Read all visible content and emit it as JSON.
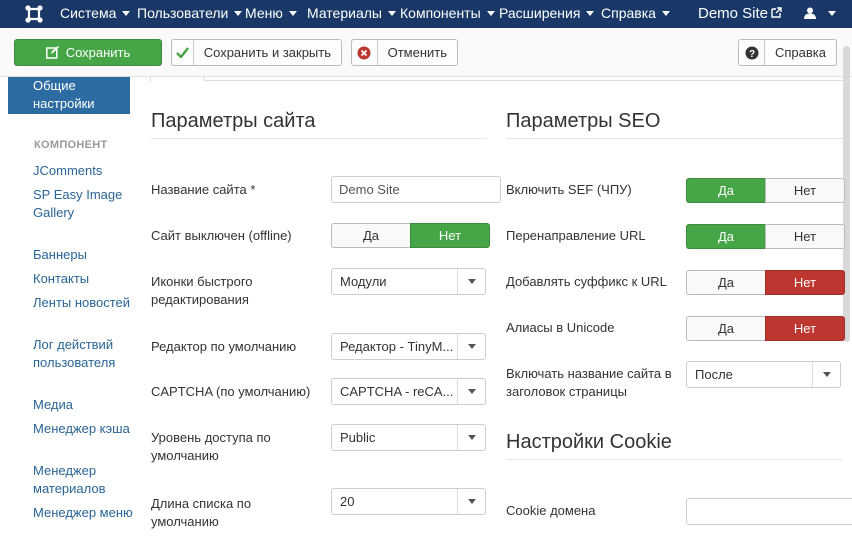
{
  "navbar": {
    "menu": [
      "Система",
      "Пользователи",
      "Меню",
      "Материалы",
      "Компоненты",
      "Расширения",
      "Справка"
    ],
    "brand": "Demo Site"
  },
  "toolbar": {
    "save": "Сохранить",
    "save_close": "Сохранить и закрыть",
    "cancel": "Отменить",
    "help": "Справка"
  },
  "sidebar": {
    "active": "Общие настройки",
    "component_heading": "КОМПОНЕНТ",
    "items": [
      "JComments",
      "SP Easy Image Gallery",
      "Баннеры",
      "Контакты",
      "Ленты новостей",
      "Лог действий пользователя",
      "Медиа",
      "Менеджер кэша",
      "Менеджер материалов",
      "Менеджер меню"
    ]
  },
  "site": {
    "title": "Параметры сайта",
    "name_label": "Название сайта *",
    "name_value": "Demo Site",
    "offline_label": "Сайт выключен (offline)",
    "offline_yes": "Да",
    "offline_no": "Нет",
    "frontedit_label": "Иконки быстрого редактирования",
    "frontedit_value": "Модули",
    "editor_label": "Редактор по умолчанию",
    "editor_value": "Редактор - TinyM...",
    "captcha_label": "CAPTCHA (по умолчанию)",
    "captcha_value": "CAPTCHA - reCA...",
    "access_label": "Уровень доступа по умолчанию",
    "access_value": "Public",
    "list_label": "Длина списка по умолчанию",
    "list_value": "20"
  },
  "seo": {
    "title": "Параметры SEO",
    "sef_label": "Включить SEF (ЧПУ)",
    "rewrite_label": "Перенаправление URL",
    "suffix_label": "Добавлять суффикс к URL",
    "unicode_label": "Алиасы в Unicode",
    "yes": "Да",
    "no": "Нет",
    "sitename_label": "Включать название сайта в заголовок страницы",
    "sitename_value": "После"
  },
  "cookie": {
    "title": "Настройки Cookie",
    "domain_label": "Cookie домена",
    "domain_value": ""
  },
  "colors": {
    "navbar": "#1a3867",
    "success": "#46a546",
    "danger": "#bd362f",
    "active_sidebar": "#2d6ca2"
  }
}
